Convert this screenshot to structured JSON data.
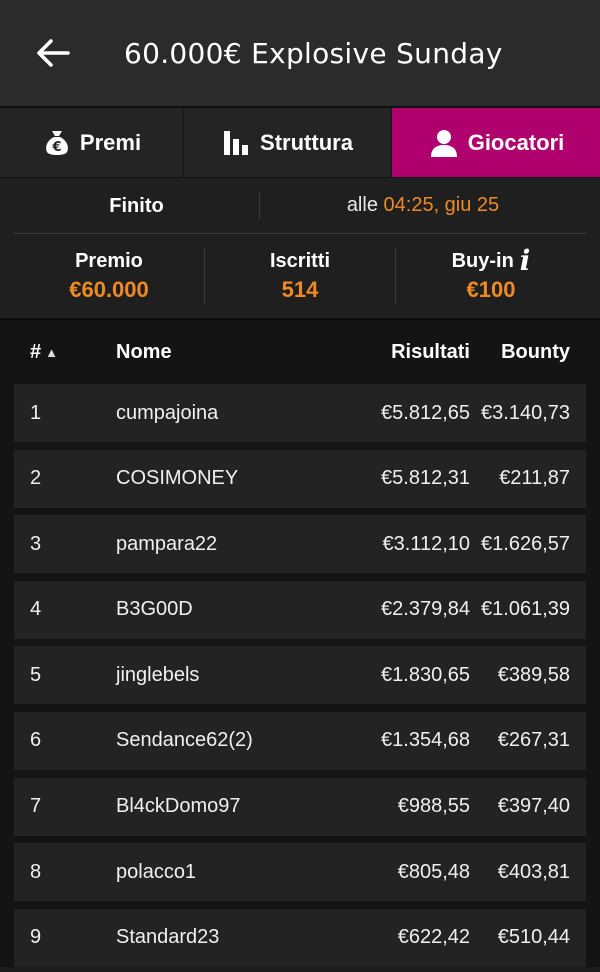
{
  "header": {
    "title": "60.000€ Explosive Sunday"
  },
  "tabs": [
    {
      "label": "Premi",
      "icon": "money-bag-icon",
      "active": false
    },
    {
      "label": "Struttura",
      "icon": "bar-chart-icon",
      "active": false
    },
    {
      "label": "Giocatori",
      "icon": "user-icon",
      "active": true
    }
  ],
  "status": {
    "state": "Finito",
    "time_prefix": "alle",
    "time": "04:25, giu 25"
  },
  "stats": {
    "prize_label": "Premio",
    "prize_value": "€60.000",
    "entrants_label": "Iscritti",
    "entrants_value": "514",
    "buyin_label": "Buy-in",
    "buyin_value": "€100"
  },
  "table": {
    "headers": {
      "rank": "#",
      "name": "Nome",
      "results": "Risultati",
      "bounty": "Bounty"
    },
    "rows": [
      {
        "rank": "1",
        "name": "cumpajoina",
        "results": "€5.812,65",
        "bounty": "€3.140,73"
      },
      {
        "rank": "2",
        "name": "COSIMONEY",
        "results": "€5.812,31",
        "bounty": "€211,87"
      },
      {
        "rank": "3",
        "name": "pampara22",
        "results": "€3.112,10",
        "bounty": "€1.626,57"
      },
      {
        "rank": "4",
        "name": "B3G00D",
        "results": "€2.379,84",
        "bounty": "€1.061,39"
      },
      {
        "rank": "5",
        "name": "jinglebels",
        "results": "€1.830,65",
        "bounty": "€389,58"
      },
      {
        "rank": "6",
        "name": "Sendance62(2)",
        "results": "€1.354,68",
        "bounty": "€267,31"
      },
      {
        "rank": "7",
        "name": "Bl4ckDomo97",
        "results": "€988,55",
        "bounty": "€397,40"
      },
      {
        "rank": "8",
        "name": "polacco1",
        "results": "€805,48",
        "bounty": "€403,81"
      },
      {
        "rank": "9",
        "name": "Standard23",
        "results": "€622,42",
        "bounty": "€510,44"
      }
    ]
  },
  "colors": {
    "accent": "#b0006e",
    "highlight": "#f08a24"
  }
}
